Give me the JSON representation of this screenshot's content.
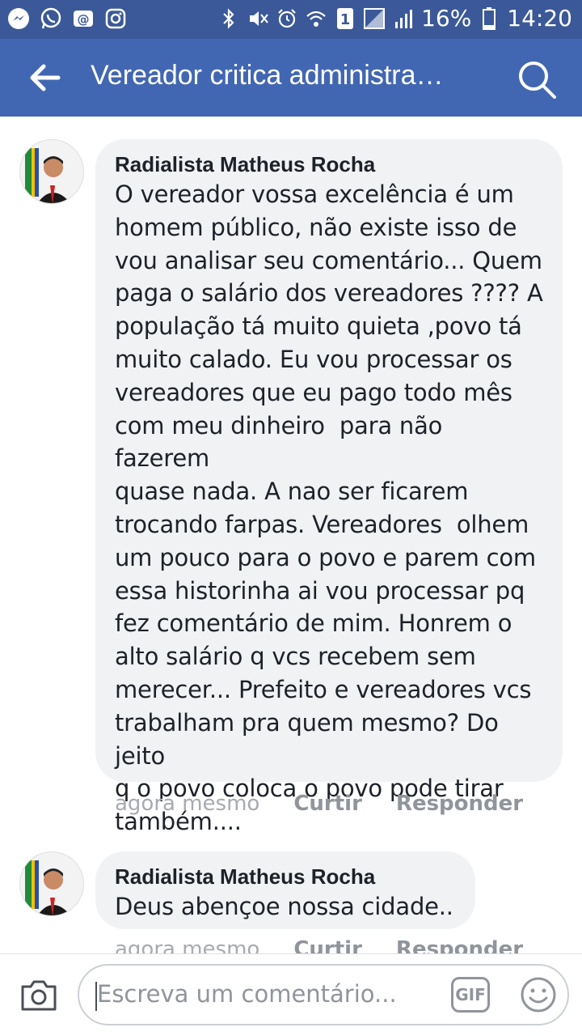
{
  "status_bar": {
    "battery": "16%",
    "time": "14:20",
    "sim_label": "1",
    "left_icons": [
      "messenger-icon",
      "whatsapp-icon",
      "email-icon",
      "instagram-icon"
    ],
    "right_icons": [
      "bluetooth-icon",
      "mute-icon",
      "alarm-icon",
      "wifi-icon",
      "sim-icon",
      "no-signal-icon",
      "signal-icon",
      "battery-icon"
    ]
  },
  "app_bar": {
    "title": "Vereador critica administra…",
    "back_icon": "arrow-left-icon",
    "search_icon": "search-icon"
  },
  "comments": [
    {
      "author": "Radialista Matheus Rocha",
      "text": "O vereador vossa excelência é um\nhomem público, não existe isso de\nvou analisar seu comentário... Quem\npaga o salário dos vereadores ???? A\npopulação tá muito quieta ,povo tá\nmuito calado. Eu vou processar os\nvereadores que eu pago todo mês\ncom meu dinheiro  para não fazerem\nquase nada. A nao ser ficarem\ntrocando farpas. Vereadores  olhem\num pouco para o povo e parem com\nessa historinha ai vou processar pq\nfez comentário de mim. Honrem o\nalto salário q vcs recebem sem\nmerecer... Prefeito e vereadores vcs\ntrabalham pra quem mesmo? Do jeito\nq o povo coloca o povo pode tirar\ntambém....",
      "time": "agora mesmo",
      "like_label": "Curtir",
      "reply_label": "Responder"
    },
    {
      "author": "Radialista Matheus Rocha",
      "text": "Deus abençoe nossa cidade..",
      "time": "agora mesmo",
      "like_label": "Curtir",
      "reply_label": "Responder"
    }
  ],
  "composer": {
    "placeholder": "Escreva um comentário...",
    "gif_label": "GIF",
    "camera_icon": "camera-icon",
    "emoji_icon": "emoji-icon"
  },
  "colors": {
    "status_bar_bg": "#3b5998",
    "app_bar_bg": "#4267b2",
    "bubble_bg": "#f1f2f4",
    "meta_text": "#90949c"
  }
}
